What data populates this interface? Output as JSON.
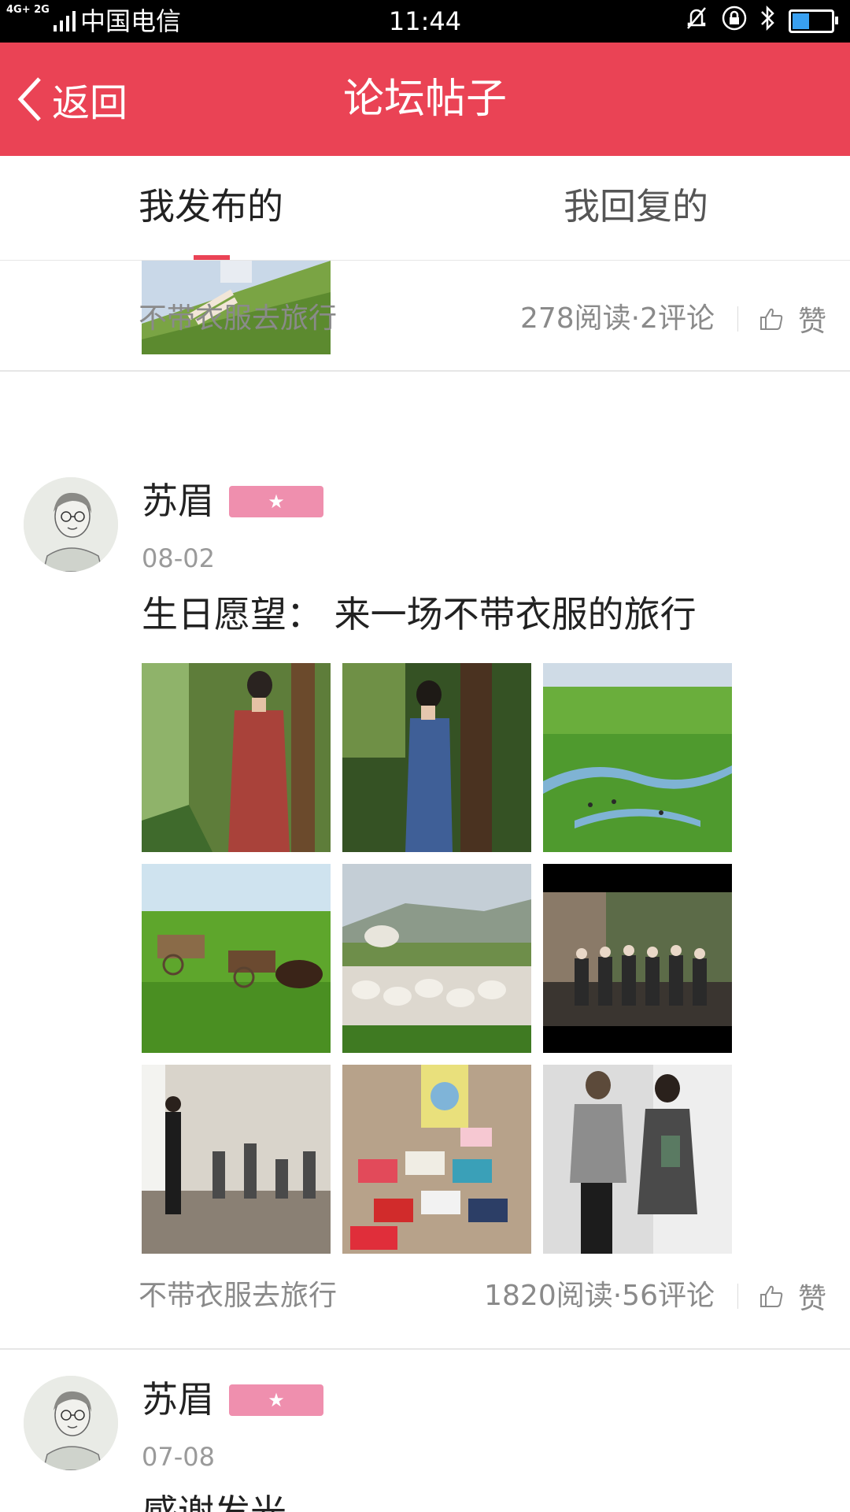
{
  "status_bar": {
    "network": "4G+ 2G",
    "carrier": "中国电信",
    "time": "11:44",
    "icons": [
      "mute-icon",
      "rotation-lock-icon",
      "bluetooth-icon",
      "battery-icon"
    ],
    "battery_level": 0.4
  },
  "header": {
    "back_label": "返回",
    "title": "论坛帖子",
    "color": "#ea4355"
  },
  "tabs": [
    {
      "label": "我发布的",
      "active": true
    },
    {
      "label": "我回复的",
      "active": false
    }
  ],
  "posts": [
    {
      "tag": "不带衣服去旅行",
      "stats": "278阅读·2评论",
      "like_label": "赞"
    },
    {
      "author": "苏眉",
      "date": "08-02",
      "title": "生日愿望： 来一场不带衣服的旅行",
      "tag": "不带衣服去旅行",
      "stats": "1820阅读·56评论",
      "like_label": "赞",
      "images": [
        "woman-red-dress-forest",
        "woman-blue-dress-trees",
        "grassland-river",
        "ox-carts-grassland",
        "sheep-flock-yurt",
        "group-photo",
        "classroom-gathering",
        "clothes-table",
        "two-women-portrait"
      ]
    },
    {
      "author": "苏眉",
      "date": "07-08",
      "title": "感谢发光"
    }
  ]
}
